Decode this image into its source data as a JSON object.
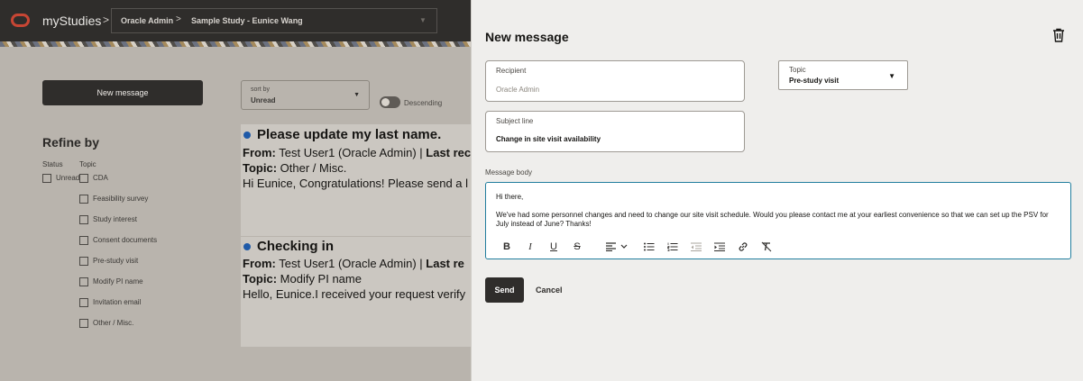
{
  "header": {
    "brand": "myStudies",
    "separator": ">",
    "breadcrumb": [
      "Oracle Admin",
      "Sample Study - Eunice Wang"
    ]
  },
  "list": {
    "new_message_label": "New message",
    "sort": {
      "label": "sort by",
      "value": "Unread"
    },
    "descending_label": "Descending",
    "refine_title": "Refine by",
    "status_heading": "Status",
    "topic_heading": "Topic",
    "status_options": [
      "Unread"
    ],
    "topic_options": [
      "CDA",
      "Feasibility survey",
      "Study interest",
      "Consent documents",
      "Pre-study visit",
      "Modify PI name",
      "Invitation email",
      "Other / Misc."
    ],
    "messages": [
      {
        "title": "Please update my last name.",
        "from_label": "From:",
        "from": "Test User1 (Oracle Admin) |",
        "last_label": "Last rec",
        "topic_label": "Topic:",
        "topic": "Other / Misc.",
        "preview": "Hi Eunice, Congratulations! Please send a l"
      },
      {
        "title": "Checking in",
        "from_label": "From:",
        "from": "Test User1 (Oracle Admin) |",
        "last_label": "Last re",
        "topic_label": "Topic:",
        "topic": "Modify PI name",
        "preview": "Hello, Eunice.I received your request verify"
      }
    ]
  },
  "drawer": {
    "title": "New message",
    "recipient": {
      "label": "Recipient",
      "value": "Oracle Admin"
    },
    "topic": {
      "label": "Topic",
      "value": "Pre-study visit"
    },
    "subject": {
      "label": "Subject line",
      "value": "Change in site visit availability"
    },
    "body_label": "Message body",
    "body_greeting": "Hi there,",
    "body_text": "We've had some personnel changes and need to change our site visit schedule. Would you please contact me at your earliest convenience so that we can set up the PSV for July instead of June? Thanks!",
    "toolbar_glyphs": {
      "bold": "B",
      "italic": "I",
      "underline": "U",
      "strike": "S"
    },
    "send_label": "Send",
    "cancel_label": "Cancel"
  },
  "colors": {
    "accent": "#c74634",
    "unread_dot": "#1f5aa8",
    "focus_border": "#227e9e"
  }
}
